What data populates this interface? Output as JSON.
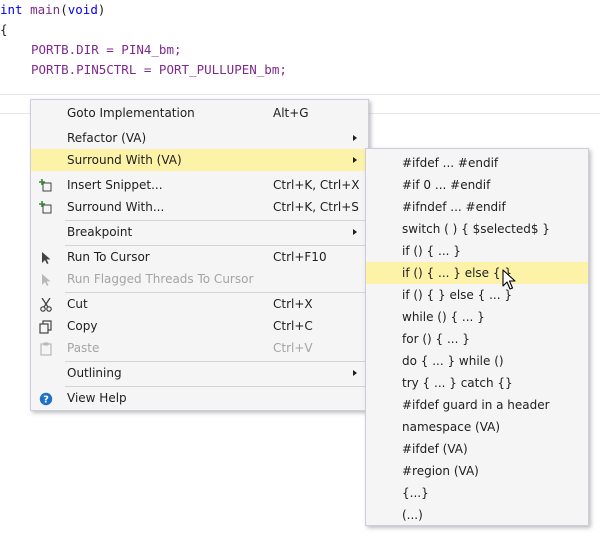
{
  "code": {
    "line1_type": "int",
    "line1_func": "main",
    "line1_open": "(",
    "line1_param": "void",
    "line1_close": ")",
    "line2": "{",
    "line3": "PORTB.DIR = PIN4_bm;",
    "line4": "PORTB.PIN5CTRL = PORT_PULLUPEN_bm;"
  },
  "context_menu": {
    "items": [
      {
        "label": "Goto Implementation",
        "shortcut": "Alt+G",
        "icon": "",
        "submenu": false,
        "disabled": false
      },
      {
        "label": "Refactor (VA)",
        "shortcut": "",
        "icon": "",
        "submenu": true,
        "disabled": false
      },
      {
        "label": "Surround With (VA)",
        "shortcut": "",
        "icon": "",
        "submenu": true,
        "disabled": false,
        "highlighted": true
      },
      {
        "label": "Insert Snippet...",
        "shortcut": "Ctrl+K, Ctrl+X",
        "icon": "insert-snippet-icon",
        "submenu": false,
        "disabled": false
      },
      {
        "label": "Surround With...",
        "shortcut": "Ctrl+K, Ctrl+S",
        "icon": "surround-with-icon",
        "submenu": false,
        "disabled": false
      },
      {
        "label": "Breakpoint",
        "shortcut": "",
        "icon": "",
        "submenu": true,
        "disabled": false
      },
      {
        "label": "Run To Cursor",
        "shortcut": "Ctrl+F10",
        "icon": "run-to-cursor-icon",
        "submenu": false,
        "disabled": false
      },
      {
        "label": "Run Flagged Threads To Cursor",
        "shortcut": "",
        "icon": "run-flagged-threads-icon",
        "submenu": false,
        "disabled": true
      },
      {
        "label": "Cut",
        "shortcut": "Ctrl+X",
        "icon": "scissors-icon",
        "submenu": false,
        "disabled": false
      },
      {
        "label": "Copy",
        "shortcut": "Ctrl+C",
        "icon": "copy-icon",
        "submenu": false,
        "disabled": false
      },
      {
        "label": "Paste",
        "shortcut": "Ctrl+V",
        "icon": "clipboard-icon",
        "submenu": false,
        "disabled": true
      },
      {
        "label": "Outlining",
        "shortcut": "",
        "icon": "",
        "submenu": true,
        "disabled": false
      },
      {
        "label": "View Help",
        "shortcut": "",
        "icon": "help-icon",
        "submenu": false,
        "disabled": false
      }
    ]
  },
  "surround_submenu": {
    "items": [
      {
        "label": "#ifdef ... #endif"
      },
      {
        "label": "#if 0 ... #endif"
      },
      {
        "label": "#ifndef ... #endif"
      },
      {
        "label": "switch ( ) { $selected$ }"
      },
      {
        "label": "if () { ... }"
      },
      {
        "label": "if () { ... } else { }",
        "highlighted": true
      },
      {
        "label": "if () { } else { ... }"
      },
      {
        "label": "while () { ... }"
      },
      {
        "label": "for () { ... }"
      },
      {
        "label": "do { ... } while ()"
      },
      {
        "label": "try { ... } catch {}"
      },
      {
        "label": "#ifdef guard in a header"
      },
      {
        "label": "namespace (VA)"
      },
      {
        "label": "#ifdef (VA)"
      },
      {
        "label": "#region (VA)"
      },
      {
        "label": "{...}"
      },
      {
        "label": "(...)"
      }
    ]
  },
  "colors": {
    "keyword": "#0000ff",
    "macro": "#7f2a8e",
    "highlight": "#fcf3a8",
    "menu_bg": "#f5f5f5"
  }
}
